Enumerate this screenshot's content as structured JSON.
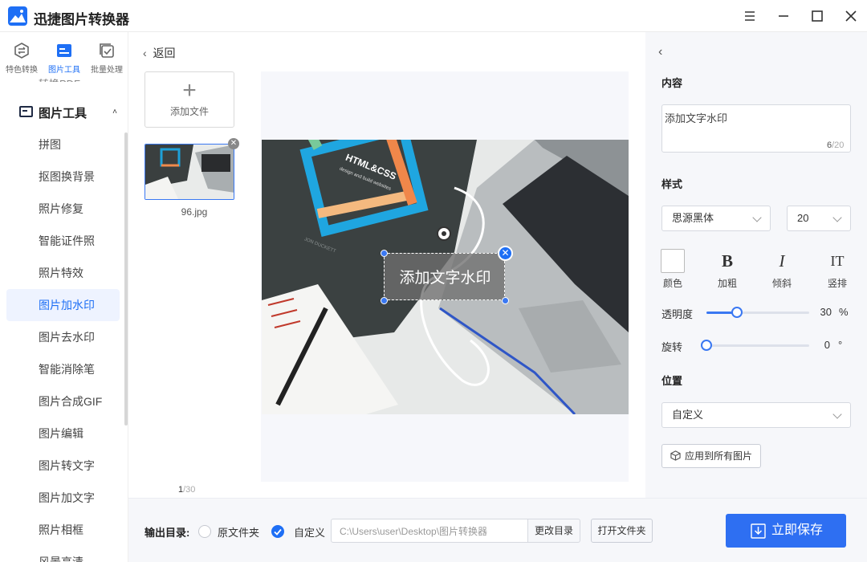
{
  "app": {
    "title": "迅捷图片转换器"
  },
  "topnav": [
    {
      "label": "特色转换"
    },
    {
      "label": "图片工具"
    },
    {
      "label": "批量处理"
    }
  ],
  "sidebar": {
    "cut_item": "转换PDF",
    "group_title": "图片工具",
    "items": [
      {
        "label": "拼图"
      },
      {
        "label": "抠图换背景"
      },
      {
        "label": "照片修复"
      },
      {
        "label": "智能证件照"
      },
      {
        "label": "照片特效"
      },
      {
        "label": "图片加水印"
      },
      {
        "label": "图片去水印"
      },
      {
        "label": "智能消除笔"
      },
      {
        "label": "图片合成GIF"
      },
      {
        "label": "图片编辑"
      },
      {
        "label": "图片转文字"
      },
      {
        "label": "图片加文字"
      },
      {
        "label": "照片相框"
      },
      {
        "label": "风景高清"
      }
    ],
    "active_index": 5
  },
  "files": {
    "back_label": "返回",
    "add_label": "添加文件",
    "items": [
      {
        "name": "96.jpg"
      }
    ],
    "page_current": "1",
    "page_total": "/30"
  },
  "preview": {
    "watermark_text": "添加文字水印",
    "photo_book_title": "HTML&CSS",
    "photo_book_subtitle": "design and build websites",
    "photo_book_author": "JON DUCKETT"
  },
  "panel": {
    "content_title": "内容",
    "content_value": "添加文字水印",
    "char_count": "6",
    "char_max": "/20",
    "style_title": "样式",
    "font_family": "思源黑体",
    "font_size": "20",
    "style_buttons": [
      {
        "glyph": "",
        "label": "颜色",
        "icon": "color-swatch-icon"
      },
      {
        "glyph": "B",
        "label": "加粗",
        "icon": "bold-icon"
      },
      {
        "glyph": "I",
        "label": "倾斜",
        "icon": "italic-icon"
      },
      {
        "glyph": "IT",
        "label": "竖排",
        "icon": "vertical-text-icon"
      }
    ],
    "opacity_label": "透明度",
    "opacity_value": "30",
    "opacity_unit": "%",
    "rotate_label": "旋转",
    "rotate_value": "0",
    "rotate_unit": "°",
    "position_title": "位置",
    "position_value": "自定义",
    "apply_label": "应用到所有图片"
  },
  "bottom": {
    "output_label": "输出目录:",
    "option_original": "原文件夹",
    "option_custom": "自定义",
    "path": "C:\\Users\\user\\Desktop\\图片转换器",
    "change_dir": "更改目录",
    "open_folder": "打开文件夹",
    "save": "立即保存"
  },
  "colors": {
    "accent": "#2e6ff2",
    "active_bg": "#eef3ff",
    "panel_bg": "#f6f7fa"
  }
}
